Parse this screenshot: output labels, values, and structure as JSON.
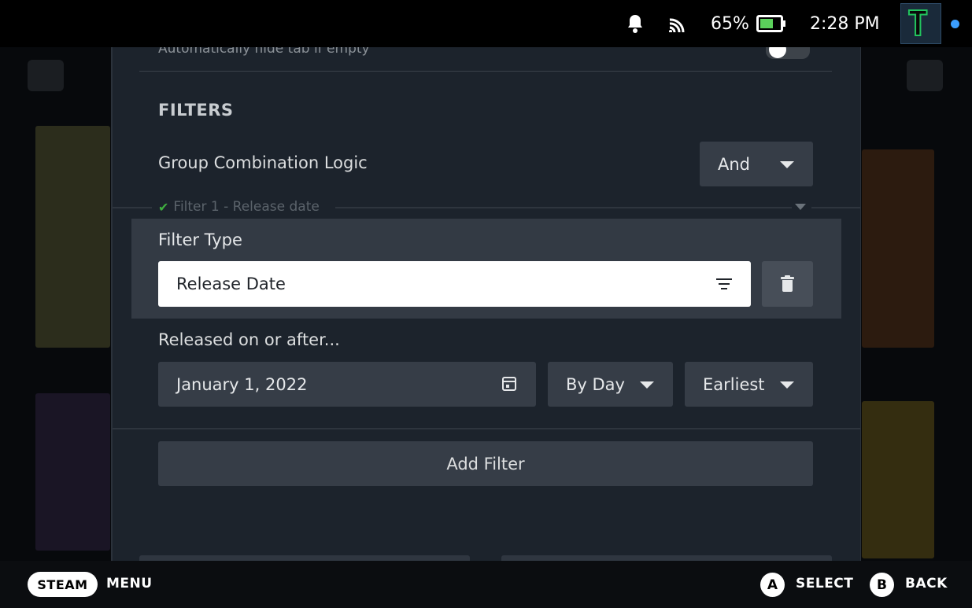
{
  "status_bar": {
    "battery_percent": "65%",
    "battery_level": 0.65,
    "time": "2:28 PM",
    "avatar_letter": "T",
    "colors": {
      "battery_fill": "#5bd15b",
      "online_dot": "#3b9eff"
    }
  },
  "panel": {
    "hide_tab_label": "Automatically hide tab if empty",
    "hide_tab_toggle_on": false,
    "filters_title": "FILTERS",
    "group_logic_label": "Group Combination Logic",
    "group_logic_value": "And",
    "filter_legend": "Filter 1 - Release date",
    "filter_type_label": "Filter Type",
    "filter_type_value": "Release Date",
    "released_label": "Released on or after...",
    "date_value": "January 1, 2022",
    "granularity_value": "By Day",
    "order_value": "Earliest",
    "add_filter_label": "Add Filter"
  },
  "footer": {
    "steam_label": "STEAM",
    "menu_label": "MENU",
    "a_glyph": "A",
    "select_label": "SELECT",
    "b_glyph": "B",
    "back_label": "BACK"
  },
  "icons": [
    "bell-icon",
    "wifi-icon",
    "battery-icon",
    "checkmark-icon",
    "caret-down-icon",
    "filter-icon",
    "trash-icon",
    "calendar-icon"
  ]
}
